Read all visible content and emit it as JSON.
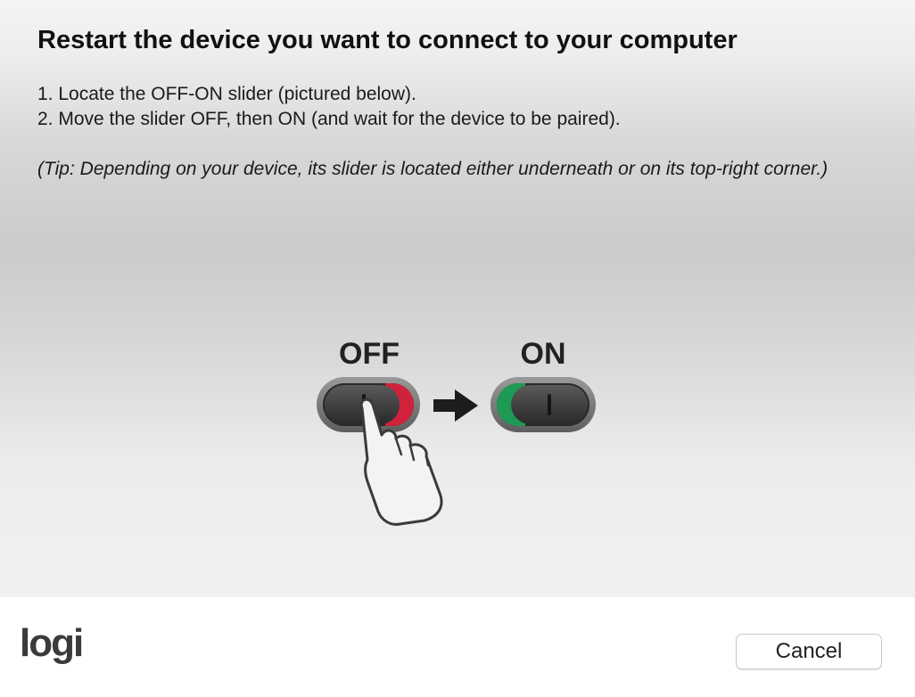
{
  "dialog": {
    "title": "Restart the device you want to connect to your computer",
    "steps": [
      "1. Locate the OFF-ON slider (pictured below).",
      "2. Move the slider OFF, then ON (and wait for the device to be paired)."
    ],
    "tip": "(Tip: Depending on your device, its slider is located either underneath or on its top-right corner.)"
  },
  "illustration": {
    "off_label": "OFF",
    "on_label": "ON",
    "off_color": "#d0223a",
    "on_color": "#1f9a55",
    "icons": [
      "hand-pointer-icon",
      "arrow-right-icon"
    ]
  },
  "footer": {
    "logo": "logi",
    "cancel_label": "Cancel"
  }
}
